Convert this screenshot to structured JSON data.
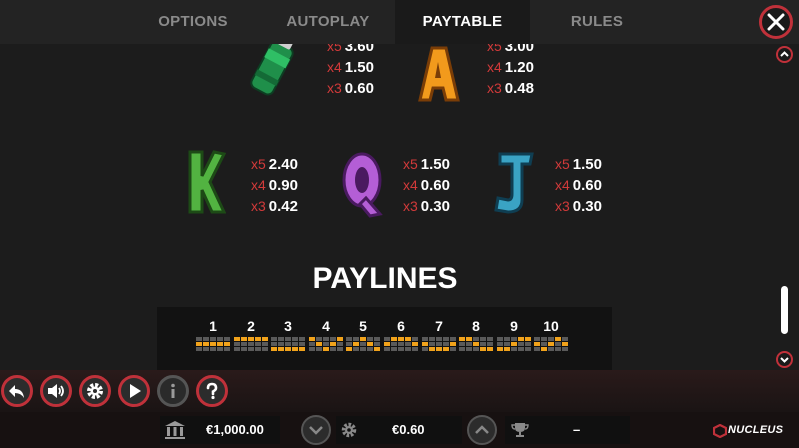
{
  "tabs": [
    {
      "label": "OPTIONS",
      "active": false
    },
    {
      "label": "AUTOPLAY",
      "active": false
    },
    {
      "label": "PAYTABLE",
      "active": true
    },
    {
      "label": "RULES",
      "active": false
    }
  ],
  "paytable": {
    "rows": [
      {
        "symbol": "spray-can",
        "pays": [
          {
            "m": "x5",
            "v": "3.60"
          },
          {
            "m": "x4",
            "v": "1.50"
          },
          {
            "m": "x3",
            "v": "0.60"
          }
        ]
      },
      {
        "symbol": "letter-a",
        "pays": [
          {
            "m": "x5",
            "v": "3.00"
          },
          {
            "m": "x4",
            "v": "1.20"
          },
          {
            "m": "x3",
            "v": "0.48"
          }
        ]
      },
      {
        "symbol": "letter-k",
        "pays": [
          {
            "m": "x5",
            "v": "2.40"
          },
          {
            "m": "x4",
            "v": "0.90"
          },
          {
            "m": "x3",
            "v": "0.42"
          }
        ]
      },
      {
        "symbol": "letter-q",
        "pays": [
          {
            "m": "x5",
            "v": "1.50"
          },
          {
            "m": "x4",
            "v": "0.60"
          },
          {
            "m": "x3",
            "v": "0.30"
          }
        ]
      },
      {
        "symbol": "letter-j",
        "pays": [
          {
            "m": "x5",
            "v": "1.50"
          },
          {
            "m": "x4",
            "v": "0.60"
          },
          {
            "m": "x3",
            "v": "0.30"
          }
        ]
      }
    ]
  },
  "paylines": {
    "title": "PAYLINES",
    "lines": [
      "1",
      "2",
      "3",
      "4",
      "5",
      "6",
      "7",
      "8",
      "9",
      "10"
    ],
    "patterns": [
      [
        1,
        1,
        1,
        1,
        1
      ],
      [
        0,
        0,
        0,
        0,
        0
      ],
      [
        2,
        2,
        2,
        2,
        2
      ],
      [
        0,
        1,
        2,
        1,
        0
      ],
      [
        2,
        1,
        0,
        1,
        2
      ],
      [
        1,
        0,
        0,
        0,
        1
      ],
      [
        1,
        2,
        2,
        2,
        1
      ],
      [
        0,
        0,
        1,
        2,
        2
      ],
      [
        2,
        2,
        1,
        0,
        0
      ],
      [
        1,
        2,
        1,
        0,
        1
      ]
    ]
  },
  "bottom": {
    "balance": "€1,000.00",
    "bet": "€0.60",
    "win": "–",
    "brand": "NUCLEUS"
  },
  "colors": {
    "accent": "#c0313a",
    "payline_on": "#f2a31b",
    "payline_off": "#5a5a5a"
  }
}
